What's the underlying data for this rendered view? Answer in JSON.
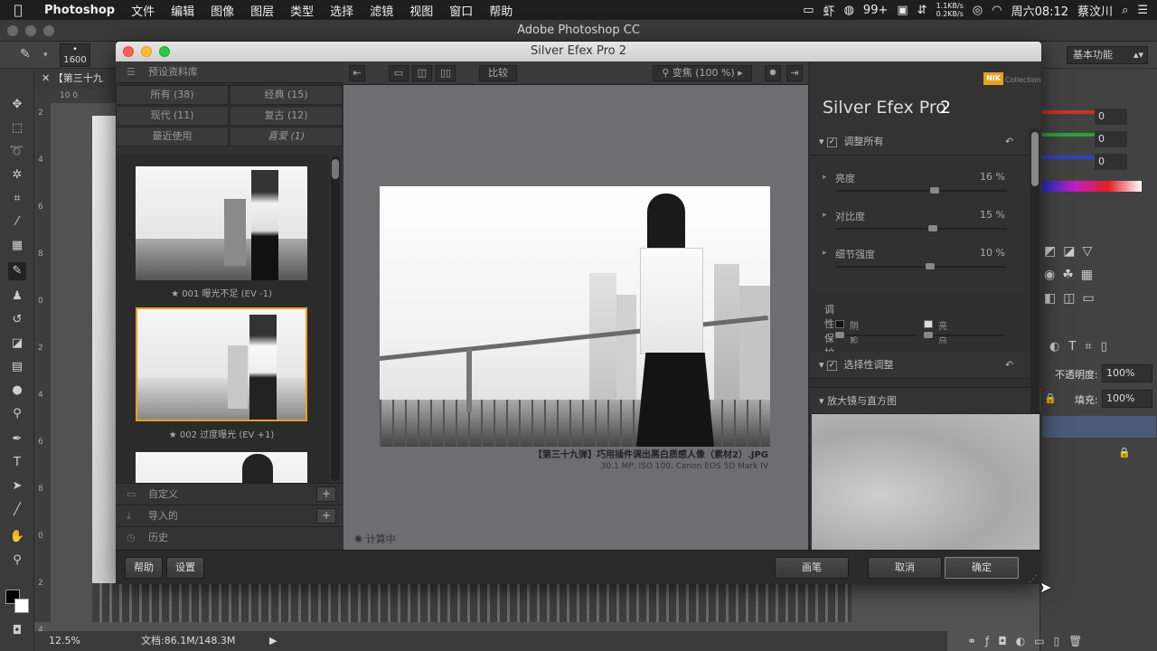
{
  "menubar": {
    "apple": "",
    "app": "Photoshop",
    "items": [
      "文件",
      "编辑",
      "图像",
      "图层",
      "类型",
      "选择",
      "滤镜",
      "视图",
      "窗口",
      "帮助"
    ],
    "badge": "99+",
    "net_up": "1.1KB/s",
    "net_down": "0.2KB/s",
    "clock": "周六08:12",
    "user": "蔡汶川"
  },
  "ps": {
    "window_title": "Adobe Photoshop CC",
    "brush_size": "1600",
    "workspace": "基本功能",
    "doc_tab": "【第三十九",
    "ruler_top": "10    0",
    "ruler_left": [
      "2",
      "4",
      "6",
      "8",
      "0",
      "2",
      "4",
      "6",
      "8",
      "0",
      "2",
      "4"
    ],
    "zoom": "12.5%",
    "doc_size": "文档:86.1M/148.3M",
    "color_values": [
      "0",
      "0",
      "0"
    ],
    "opacity_label": "不透明度:",
    "opacity_value": "100%",
    "fill_label": "填充:",
    "fill_value": "100%"
  },
  "sep": {
    "title": "Silver Efex Pro 2",
    "preset_library": "预设资料库",
    "categories": [
      {
        "label": "所有 (38)"
      },
      {
        "label": "经典 (15)"
      },
      {
        "label": "现代 (11)"
      },
      {
        "label": "复古 (12)"
      },
      {
        "label": "最近使用"
      },
      {
        "label": "喜爱 (1)"
      }
    ],
    "presets": [
      {
        "label": "★ 001 曝光不足 (EV -1)"
      },
      {
        "label": "★ 002 过度曝光 (EV +1)"
      }
    ],
    "sections": [
      "自定义",
      "导入的",
      "历史"
    ],
    "toolbar": {
      "compare": "比较",
      "zoom": "变焦 (100 %)"
    },
    "photo_caption": "【第三十九弹】巧用插件调出黑白质感人像（素材2）.JPG",
    "photo_meta": "30.1 MP, ISO 100, Canon EOS 5D Mark IV",
    "calculating": "计算中",
    "right": {
      "brand_logo": "NIK",
      "brand_collection": "Collection",
      "product_name": "Silver Efex Pro",
      "product_version": "2",
      "adjust_all": "调整所有",
      "sliders": [
        {
          "label": "亮度",
          "value": "16 %",
          "level": 0.58
        },
        {
          "label": "对比度",
          "value": "15 %",
          "level": 0.57
        },
        {
          "label": "细节强度",
          "value": "10 %",
          "level": 0.55
        }
      ],
      "tonal_protection": "调性保护",
      "shadows": "阴影",
      "highlights": "亮点",
      "selective": "选择性调整",
      "loupe": "放大镜与直方图"
    },
    "bottom": {
      "help": "帮助",
      "settings": "设置",
      "brush": "画笔",
      "cancel": "取消",
      "ok": "确定"
    }
  },
  "colors": {
    "selected_border": "#f0a020",
    "nik_logo": "#e8a020"
  }
}
